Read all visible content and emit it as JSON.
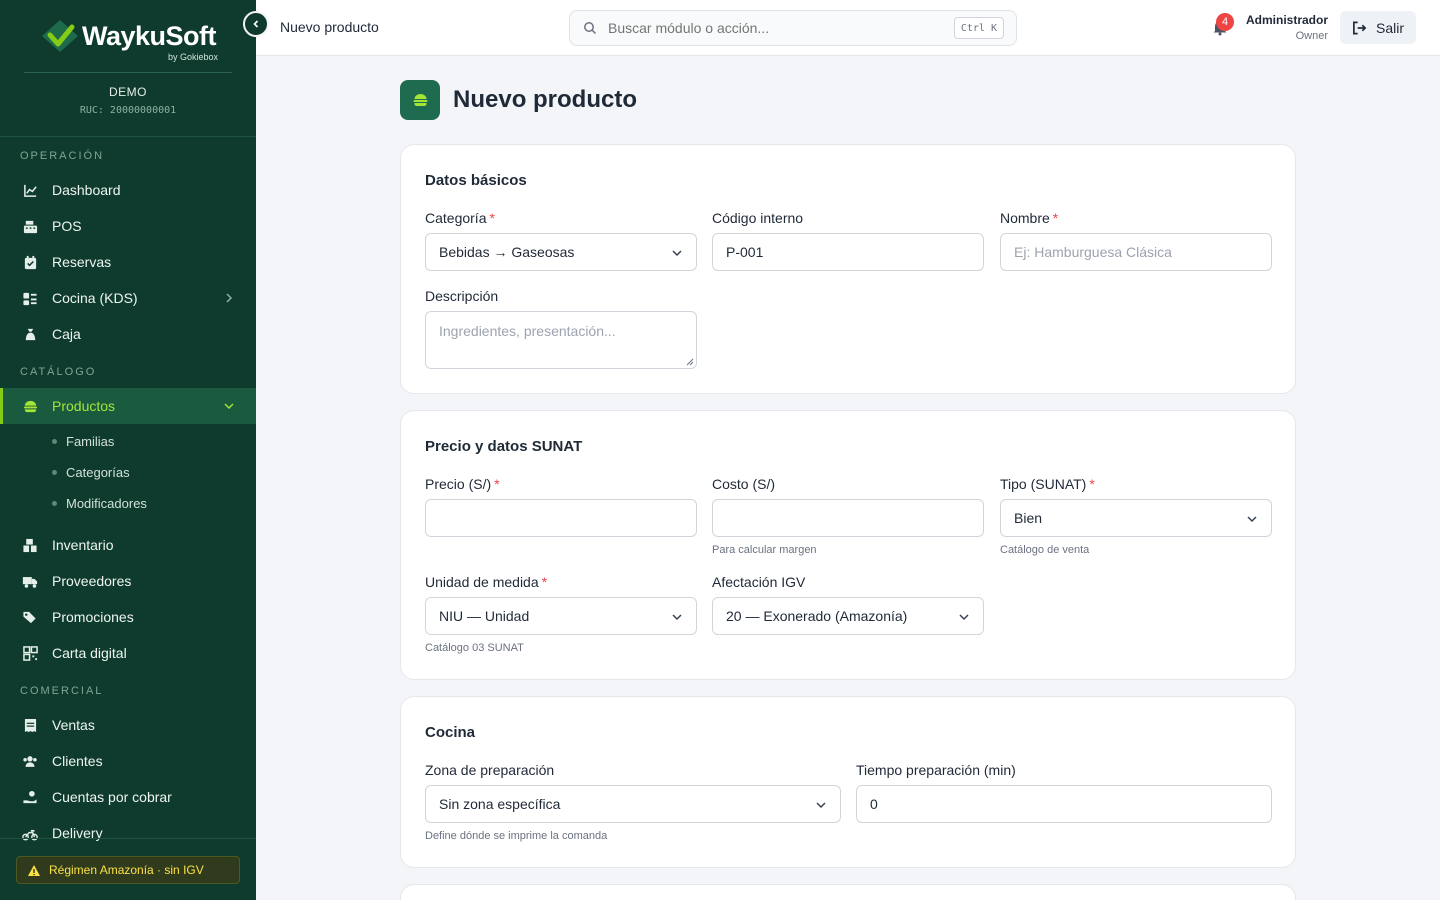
{
  "brand": {
    "name": "WaykuSoft",
    "sub": "by Gokiebox",
    "tenant": "DEMO",
    "ruc": "RUC: 20000000001"
  },
  "sidebar": {
    "sections": {
      "operacion": "OPERACIÓN",
      "catalogo": "CATÁLOGO",
      "comercial": "COMERCIAL"
    },
    "items": [
      {
        "label": "Dashboard",
        "icon": "chart-line-icon"
      },
      {
        "label": "POS",
        "icon": "cash-register-icon"
      },
      {
        "label": "Reservas",
        "icon": "calendar-check-icon"
      },
      {
        "label": "Cocina (KDS)",
        "icon": "kitchen-icon"
      },
      {
        "label": "Caja",
        "icon": "money-bag-icon"
      },
      {
        "label": "Productos",
        "icon": "burger-icon"
      },
      {
        "label": "Inventario",
        "icon": "boxes-icon"
      },
      {
        "label": "Proveedores",
        "icon": "truck-icon"
      },
      {
        "label": "Promociones",
        "icon": "tags-icon"
      },
      {
        "label": "Carta digital",
        "icon": "qr-code-icon"
      },
      {
        "label": "Ventas",
        "icon": "receipt-icon"
      },
      {
        "label": "Clientes",
        "icon": "users-icon"
      },
      {
        "label": "Cuentas por cobrar",
        "icon": "hand-coin-icon"
      },
      {
        "label": "Delivery",
        "icon": "motorcycle-icon"
      }
    ],
    "sub_items": [
      "Familias",
      "Categorías",
      "Modificadores"
    ],
    "regime": "Régimen Amazonía · sin IGV"
  },
  "header": {
    "title": "Nuevo producto",
    "search_placeholder": "Buscar módulo o acción...",
    "search_shortcut": "Ctrl K",
    "notifications": "4",
    "user_name": "Administrador",
    "user_role": "Owner",
    "logout": "Salir"
  },
  "page": {
    "title": "Nuevo producto"
  },
  "basic": {
    "title": "Datos básicos",
    "categoria_label": "Categoría",
    "categoria_value": "Bebidas → Gaseosas",
    "codigo_label": "Código interno",
    "codigo_value": "P-001",
    "nombre_label": "Nombre",
    "nombre_placeholder": "Ej: Hamburguesa Clásica",
    "descripcion_label": "Descripción",
    "descripcion_placeholder": "Ingredientes, presentación..."
  },
  "price": {
    "title": "Precio y datos SUNAT",
    "precio_label": "Precio (S/)",
    "costo_label": "Costo (S/)",
    "costo_hint": "Para calcular margen",
    "tipo_label": "Tipo (SUNAT)",
    "tipo_value": "Bien",
    "tipo_hint": "Catálogo de venta",
    "unidad_label": "Unidad de medida",
    "unidad_value": "NIU — Unidad",
    "unidad_hint": "Catálogo 03 SUNAT",
    "igv_label": "Afectación IGV",
    "igv_value": "20 — Exonerado (Amazonía)"
  },
  "kitchen": {
    "title": "Cocina",
    "zona_label": "Zona de preparación",
    "zona_value": "Sin zona específica",
    "zona_hint": "Define dónde se imprime la comanda",
    "tiempo_label": "Tiempo preparación (min)",
    "tiempo_value": "0"
  },
  "colors": {
    "sidebar": "#0f3b2e",
    "accent": "#84cc16",
    "danger": "#ef4444"
  }
}
